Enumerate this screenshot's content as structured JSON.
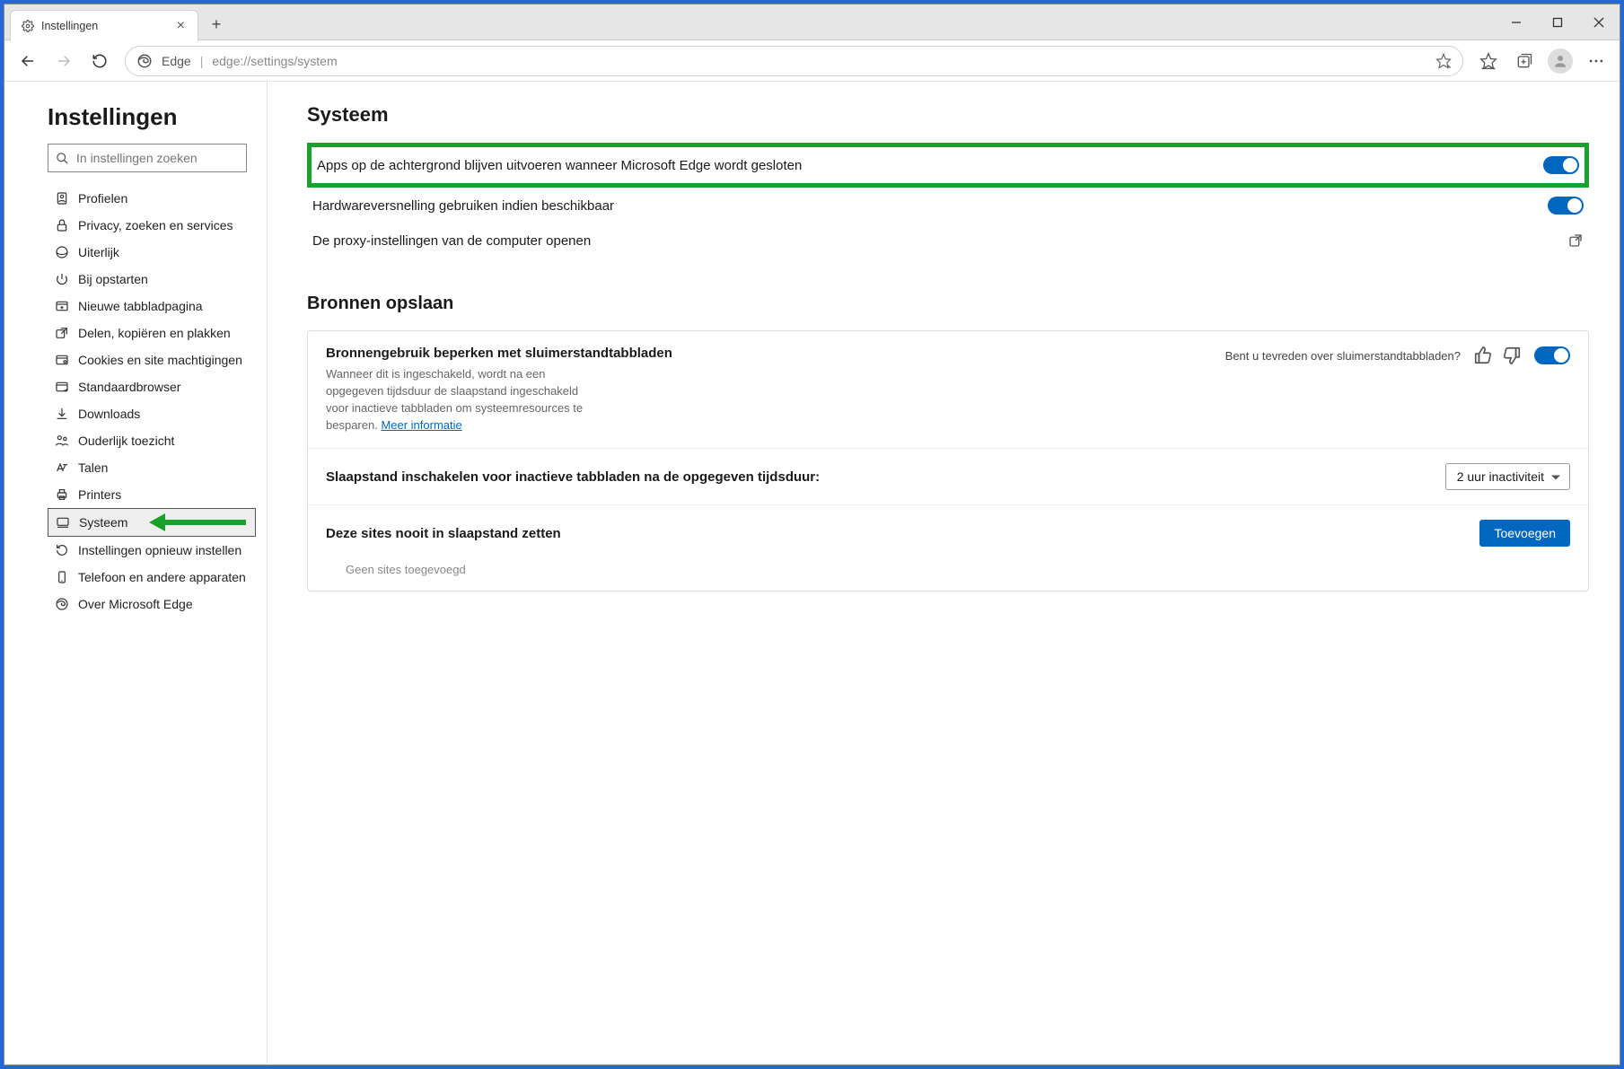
{
  "tab": {
    "title": "Instellingen"
  },
  "address": {
    "label": "Edge",
    "url": "edge://settings/system"
  },
  "search": {
    "placeholder": "In instellingen zoeken"
  },
  "sidebar": {
    "title": "Instellingen",
    "items": [
      {
        "label": "Profielen"
      },
      {
        "label": "Privacy, zoeken en services"
      },
      {
        "label": "Uiterlijk"
      },
      {
        "label": "Bij opstarten"
      },
      {
        "label": "Nieuwe tabbladpagina"
      },
      {
        "label": "Delen, kopiëren en plakken"
      },
      {
        "label": "Cookies en site machtigingen"
      },
      {
        "label": "Standaardbrowser"
      },
      {
        "label": "Downloads"
      },
      {
        "label": "Ouderlijk toezicht"
      },
      {
        "label": "Talen"
      },
      {
        "label": "Printers"
      },
      {
        "label": "Systeem"
      },
      {
        "label": "Instellingen opnieuw instellen"
      },
      {
        "label": "Telefoon en andere apparaten"
      },
      {
        "label": "Over Microsoft Edge"
      }
    ]
  },
  "main": {
    "heading": "Systeem",
    "row_bg_apps": "Apps op de achtergrond blijven uitvoeren wanneer Microsoft Edge wordt gesloten",
    "row_hw": "Hardwareversnelling gebruiken indien beschikbaar",
    "row_proxy": "De proxy-instellingen van de computer openen",
    "resources_heading": "Bronnen opslaan",
    "sleep": {
      "title": "Bronnengebruik beperken met sluimerstandtabbladen",
      "desc": "Wanneer dit is ingeschakeld, wordt na een opgegeven tijdsduur de slaapstand ingeschakeld voor inactieve tabbladen om systeemresources te besparen. ",
      "link": "Meer informatie",
      "feedback_q": "Bent u tevreden over sluimerstandtabbladen?"
    },
    "sleep_after": {
      "label": "Slaapstand inschakelen voor inactieve tabbladen na de opgegeven tijdsduur:",
      "value": "2 uur inactiviteit"
    },
    "never_sleep": {
      "label": "Deze sites nooit in slaapstand zetten",
      "button": "Toevoegen",
      "empty": "Geen sites toegevoegd"
    }
  }
}
